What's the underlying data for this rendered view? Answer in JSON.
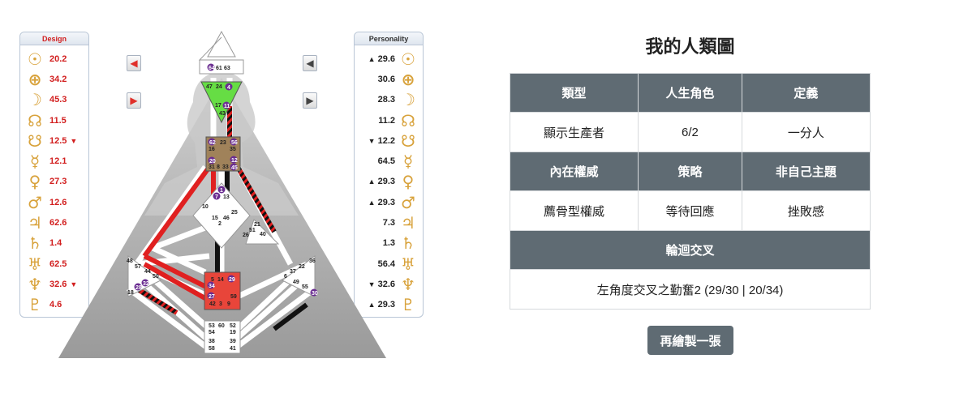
{
  "design_panel": {
    "title": "Design",
    "rows": [
      {
        "planet": "sun",
        "symbol": "☉",
        "value": "20.2",
        "mark": ""
      },
      {
        "planet": "earth",
        "symbol": "⊕",
        "value": "34.2",
        "mark": ""
      },
      {
        "planet": "moon",
        "symbol": "☽",
        "value": "45.3",
        "mark": ""
      },
      {
        "planet": "north-node",
        "symbol": "☊",
        "value": "11.5",
        "mark": ""
      },
      {
        "planet": "south-node",
        "symbol": "☋",
        "value": "12.5",
        "mark": "▼"
      },
      {
        "planet": "mercury",
        "symbol": "☿",
        "value": "12.1",
        "mark": ""
      },
      {
        "planet": "venus",
        "symbol": "♀",
        "value": "27.3",
        "mark": ""
      },
      {
        "planet": "mars",
        "symbol": "♂",
        "value": "12.6",
        "mark": ""
      },
      {
        "planet": "jupiter",
        "symbol": "♃",
        "value": "62.6",
        "mark": ""
      },
      {
        "planet": "saturn",
        "symbol": "♄",
        "value": "1.4",
        "mark": ""
      },
      {
        "planet": "uranus",
        "symbol": "♅",
        "value": "62.5",
        "mark": ""
      },
      {
        "planet": "neptune",
        "symbol": "♆",
        "value": "32.6",
        "mark": "▼"
      },
      {
        "planet": "pluto",
        "symbol": "♇",
        "value": "4.6",
        "mark": ""
      }
    ]
  },
  "personality_panel": {
    "title": "Personality",
    "rows": [
      {
        "planet": "sun",
        "symbol": "☉",
        "value": "29.6",
        "mark": "▲"
      },
      {
        "planet": "earth",
        "symbol": "⊕",
        "value": "30.6",
        "mark": ""
      },
      {
        "planet": "moon",
        "symbol": "☽",
        "value": "28.3",
        "mark": ""
      },
      {
        "planet": "north-node",
        "symbol": "☊",
        "value": "11.2",
        "mark": ""
      },
      {
        "planet": "south-node",
        "symbol": "☋",
        "value": "12.2",
        "mark": "▼"
      },
      {
        "planet": "mercury",
        "symbol": "☿",
        "value": "64.5",
        "mark": ""
      },
      {
        "planet": "venus",
        "symbol": "♀",
        "value": "29.3",
        "mark": "▲"
      },
      {
        "planet": "mars",
        "symbol": "♂",
        "value": "29.3",
        "mark": "▲"
      },
      {
        "planet": "jupiter",
        "symbol": "♃",
        "value": "7.3",
        "mark": ""
      },
      {
        "planet": "saturn",
        "symbol": "♄",
        "value": "1.3",
        "mark": ""
      },
      {
        "planet": "uranus",
        "symbol": "♅",
        "value": "56.4",
        "mark": ""
      },
      {
        "planet": "neptune",
        "symbol": "♆",
        "value": "32.6",
        "mark": "▼"
      },
      {
        "planet": "pluto",
        "symbol": "♇",
        "value": "29.3",
        "mark": "▲"
      }
    ]
  },
  "nav": {
    "prev_symbol": "◀",
    "next_symbol": "▶"
  },
  "bodygraph": {
    "gates": {
      "head": [
        "64",
        "61",
        "63"
      ],
      "ajna_top": [
        "47",
        "24",
        "4"
      ],
      "ajna_bottom": [
        "17",
        "11",
        "43"
      ],
      "throat": [
        "62",
        "23",
        "56",
        "16",
        "35",
        "20",
        "12",
        "45",
        "31",
        "8",
        "33"
      ],
      "g": [
        "7",
        "1",
        "13",
        "10",
        "15",
        "46",
        "25",
        "2"
      ],
      "ego": [
        "21",
        "26",
        "51",
        "40"
      ],
      "spleen": [
        "48",
        "57",
        "44",
        "50",
        "32",
        "28",
        "18"
      ],
      "solar_plexus": [
        "36",
        "22",
        "37",
        "6",
        "49",
        "55",
        "30"
      ],
      "sacral": [
        "5",
        "14",
        "29",
        "34",
        "27",
        "59",
        "42",
        "3",
        "9"
      ],
      "root": [
        "53",
        "60",
        "52",
        "54",
        "19",
        "38",
        "39",
        "58",
        "41"
      ]
    }
  },
  "result": {
    "title": "我的人類圖",
    "headers1": [
      "類型",
      "人生角色",
      "定義"
    ],
    "values1": [
      "顯示生產者",
      "6/2",
      "一分人"
    ],
    "headers2": [
      "內在權威",
      "策略",
      "非自己主題"
    ],
    "values2": [
      "薦骨型權威",
      "等待回應",
      "挫敗感"
    ],
    "cross_header": "輪迴交叉",
    "cross_value": "左角度交叉之勤奮2 (29/30 | 20/34)",
    "redraw_button": "再繪製一張"
  },
  "colors": {
    "design_red": "#d21f1f",
    "header_bg": "#5f6b73",
    "ajna_green": "#66dd44",
    "throat_brown": "#a0825a",
    "sacral_red": "#e8453a",
    "active_gate_purple": "#6a2c91"
  }
}
